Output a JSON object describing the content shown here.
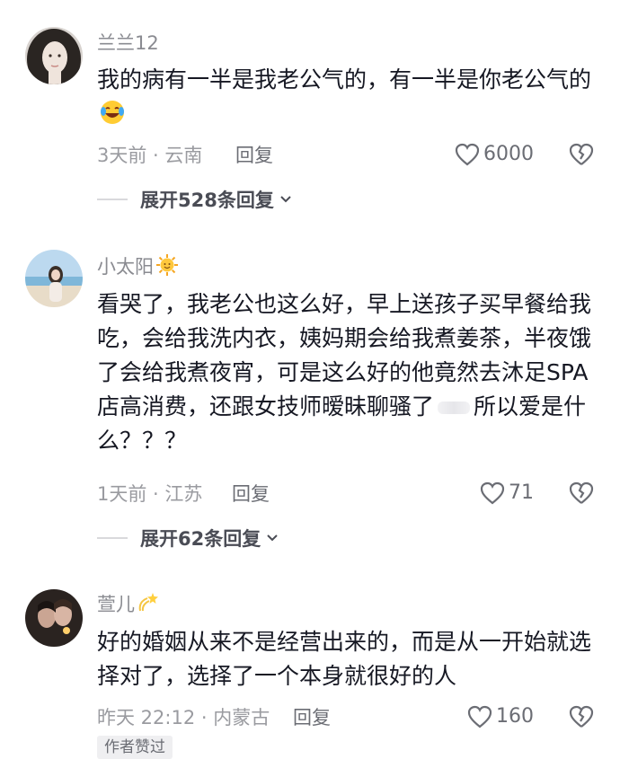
{
  "comments": [
    {
      "username": "兰兰12",
      "text": "我的病有一半是我老公气的，有一半是你老公气的",
      "text_emoji": "crying-laughing-emoji",
      "meta": "3天前 · 云南",
      "reply_label": "回复",
      "likes": "6000",
      "expand_label": "展开528条回复"
    },
    {
      "username": "小太阳",
      "username_emoji": "sun-emoji",
      "text_part1": "看哭了，我老公也这么好，早上送孩子买早餐给我吃，会给我洗内衣，姨妈期会给我煮姜茶，半夜饿了会给我煮夜宵，可是这么好的他竟然去沐足SPA店高消费，还跟女技师暧昧聊骚了",
      "text_part2": "所以爱是什么？？？",
      "meta": "1天前 · 江苏",
      "reply_label": "回复",
      "likes": "71",
      "expand_label": "展开62条回复"
    },
    {
      "username": "萱儿",
      "username_emoji": "dizzy-emoji",
      "text": "好的婚姻从来不是经营出来的，而是从一开始就选择对了，选择了一个本身就很好的人",
      "meta": "昨天 22:12 · 内蒙古",
      "reply_label": "回复",
      "likes": "160",
      "badge": "作者赞过"
    }
  ],
  "colors": {
    "text": "#161823",
    "meta": "#9a9ba0",
    "username": "#8a8b91"
  }
}
